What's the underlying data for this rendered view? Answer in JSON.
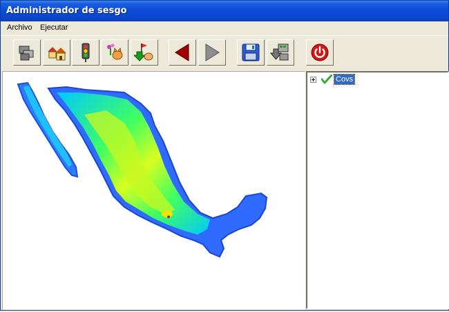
{
  "window": {
    "title": "Administrador de sesgo"
  },
  "menubar": {
    "items": [
      "Archivo",
      "Ejecutar"
    ]
  },
  "toolbar": {
    "buttons": [
      {
        "icon": "layers-icon"
      },
      {
        "icon": "houses-icon"
      },
      {
        "icon": "traffic-light-icon"
      },
      {
        "icon": "flowers-cat-icon"
      },
      {
        "icon": "download-flag-icon"
      },
      {
        "icon": "back-arrow-icon"
      },
      {
        "icon": "forward-arrow-icon"
      },
      {
        "icon": "save-icon"
      },
      {
        "icon": "export-icon"
      },
      {
        "icon": "power-icon"
      }
    ]
  },
  "tree": {
    "items": [
      {
        "label": "Covs",
        "checked": true,
        "expanded": false
      }
    ]
  },
  "colors": {
    "titlebar": "#0a4ad8",
    "selection": "#316ac5",
    "map_low": "#0033ff",
    "map_mid": "#00ff66",
    "map_high": "#ffff00"
  }
}
